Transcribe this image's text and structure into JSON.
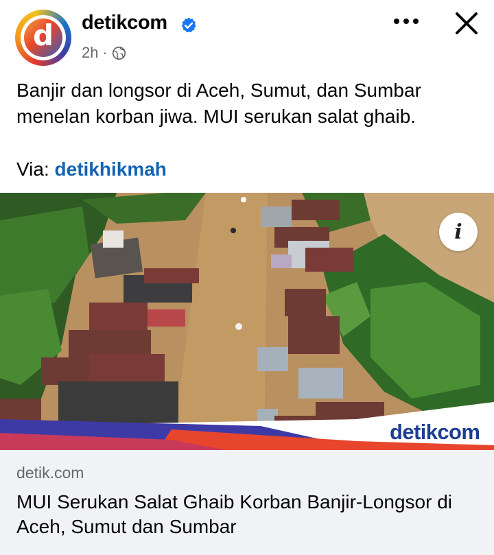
{
  "post": {
    "page_name": "detikcom",
    "avatar_letter": "d",
    "time": "2h",
    "separator": "·",
    "text": "Banjir dan longsor di Aceh, Sumut, dan Sumbar menelan korban jiwa. MUI serukan salat ghaib.",
    "via_label": "Via:",
    "via_link": "detikhikmah"
  },
  "photo": {
    "info_glyph": "i",
    "watermark_prefix": "detik",
    "watermark_suffix": "com"
  },
  "link_preview": {
    "domain": "detik.com",
    "title": "MUI Serukan Salat Ghaib Korban Banjir-Longsor di Aceh, Sumut dan Sumbar"
  },
  "icons": {
    "verified": "verified-badge-icon",
    "audience": "globe-icon",
    "more": "more-horizontal-icon",
    "close": "close-icon",
    "info": "info-icon"
  },
  "colors": {
    "verified_blue": "#1877f2",
    "link_blue": "#1464b4",
    "watermark_navy": "#1d3f93",
    "watermark_orange": "#e8452d",
    "meta_grey": "#65676b",
    "card_bg": "#f0f2f5"
  }
}
